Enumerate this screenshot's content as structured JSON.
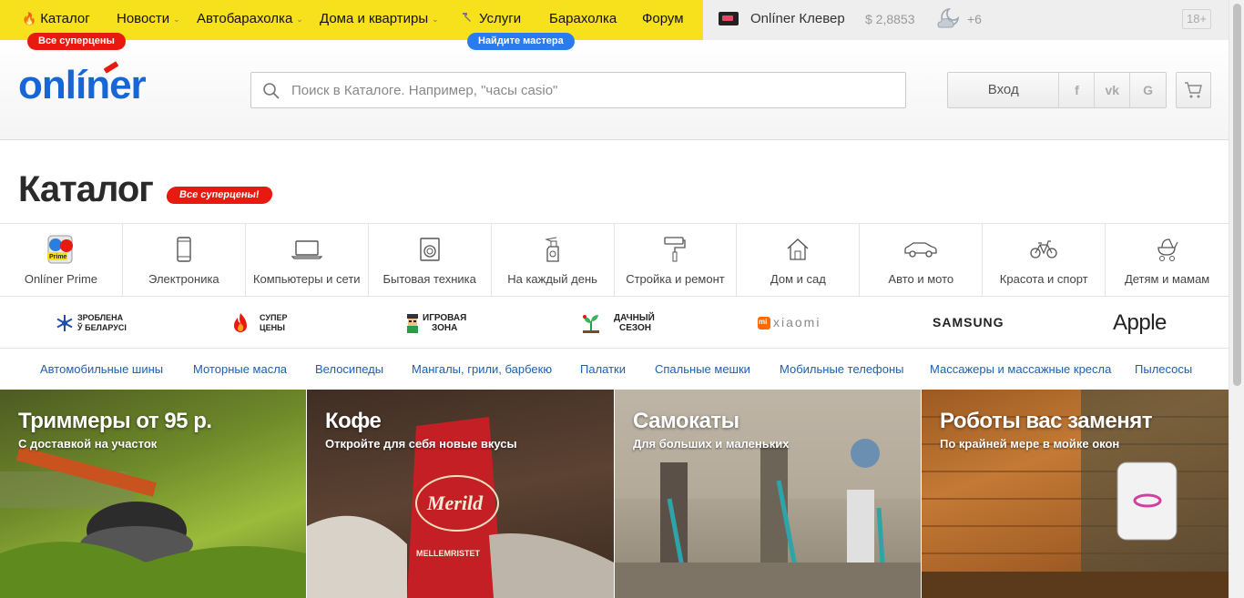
{
  "topbar": {
    "nav": [
      {
        "label": "Каталог",
        "icon": "fire-icon"
      },
      {
        "label": "Новости",
        "has_dropdown": true
      },
      {
        "label": "Автобарахолка",
        "has_dropdown": true
      },
      {
        "label": "Дома и квартиры",
        "has_dropdown": true
      },
      {
        "label": "Услуги",
        "icon": "hammer-icon"
      },
      {
        "label": "Барахолка"
      },
      {
        "label": "Форум"
      }
    ],
    "catalog_badge": "Все суперцены",
    "services_badge": "Найдите мастера",
    "clever": "Onlíner Клевер",
    "rate": "$ 2,8853",
    "weather": "+6",
    "age": "18+"
  },
  "header": {
    "logo": "onlíner",
    "search_placeholder": "Поиск в Каталоге. Например, \"часы casio\"",
    "login": "Вход",
    "socials": [
      "f",
      "vk",
      "G"
    ]
  },
  "catalog": {
    "title": "Каталог",
    "badge": "Все суперцены!",
    "categories": [
      {
        "label": "Onlíner Prime",
        "icon": "prime-icon"
      },
      {
        "label": "Электроника",
        "icon": "phone-icon"
      },
      {
        "label": "Компьютеры и сети",
        "icon": "laptop-icon"
      },
      {
        "label": "Бытовая техника",
        "icon": "washing-machine-icon"
      },
      {
        "label": "На каждый день",
        "icon": "spray-bottle-icon"
      },
      {
        "label": "Стройка и ремонт",
        "icon": "paint-roller-icon"
      },
      {
        "label": "Дом и сад",
        "icon": "house-icon"
      },
      {
        "label": "Авто и мото",
        "icon": "car-icon"
      },
      {
        "label": "Красота и спорт",
        "icon": "bicycle-icon"
      },
      {
        "label": "Детям и мамам",
        "icon": "stroller-icon"
      }
    ],
    "brands": [
      {
        "line1": "ЗРОБЛЕНА",
        "line2": "Ў БЕЛАРУСІ",
        "icon": "snowflake-icon"
      },
      {
        "line1": "СУПЕР",
        "line2": "ЦЕНЫ",
        "icon": "flame-icon"
      },
      {
        "line1": "ИГРОВАЯ",
        "line2": "ЗОНА",
        "icon": "gamer-icon"
      },
      {
        "line1": "ДАЧНЫЙ",
        "line2": "СЕЗОН",
        "icon": "seedling-icon"
      },
      {
        "line1": "xiaomi",
        "line2": "",
        "icon": "xiaomi-logo-icon"
      },
      {
        "line1": "SAMSUNG",
        "line2": ""
      },
      {
        "line1": "Apple",
        "line2": ""
      }
    ],
    "quick_links": [
      "Автомобильные шины",
      "Моторные масла",
      "Велосипеды",
      "Мангалы, грили, барбекю",
      "Палатки",
      "Спальные мешки",
      "Мобильные телефоны",
      "Массажеры и массажные кресла",
      "Пылесосы"
    ],
    "promos": [
      {
        "title": "Триммеры от 95 р.",
        "subtitle": "С доставкой на участок"
      },
      {
        "title": "Кофе",
        "subtitle": "Откройте для себя новые вкусы"
      },
      {
        "title": "Самокаты",
        "subtitle": "Для больших и маленьких"
      },
      {
        "title": "Роботы вас заменят",
        "subtitle": "По крайней мере в мойке окон"
      }
    ]
  },
  "colors": {
    "brand_blue": "#1666d6",
    "topbar_yellow": "#f7e11c",
    "badge_red": "#e8190f",
    "badge_blue": "#2b7bf0",
    "link_blue": "#1c5fb3"
  }
}
